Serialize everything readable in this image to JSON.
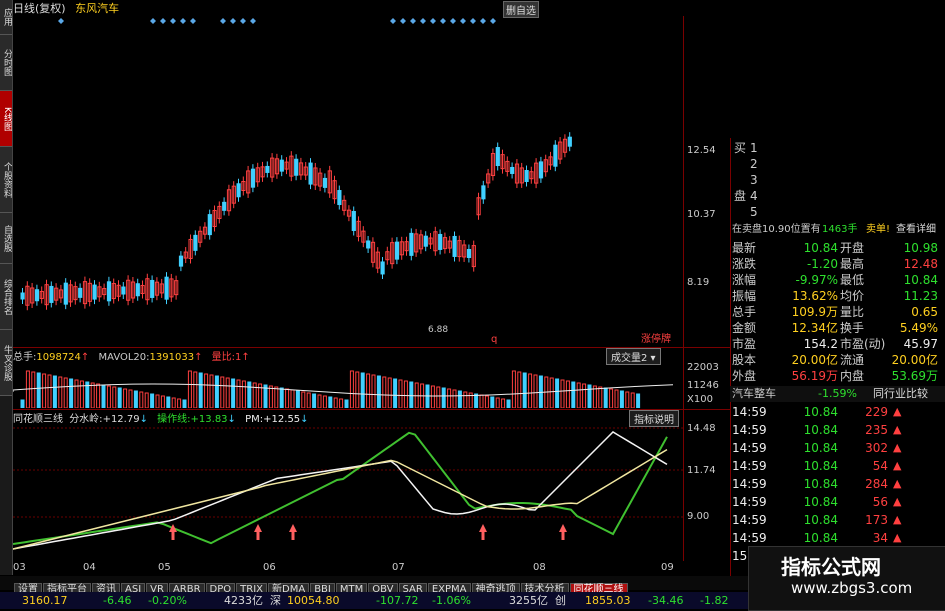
{
  "sidebar": {
    "tabs": [
      "应用",
      "分时图",
      "K线图",
      "个股资料",
      "自选股",
      "综合排名",
      "牛叉诊股"
    ]
  },
  "header": {
    "period": "日线(复权)",
    "stock_name": "东风汽车",
    "delete_button": "删自选"
  },
  "main_chart": {
    "price_axis": [
      "12.54",
      "10.37",
      "8.19"
    ],
    "low_marker": "6.88",
    "q_marker": "q",
    "zhangting_label": "涨停牌"
  },
  "volume": {
    "title": "总手:",
    "total": "1098724",
    "ma_label": "MAVOL20:",
    "ma_value": "1391033",
    "ratio_label": "量比:",
    "ratio_value": "1",
    "select_label": "成交量2",
    "axis": [
      "22003",
      "11246",
      "X100"
    ]
  },
  "indicator": {
    "name": "同花顺三线",
    "fs_label": "分水岭:",
    "fs_value": "+12.79",
    "op_label": "操作线:",
    "op_value": "+13.83",
    "pm_label": "PM:",
    "pm_value": "+12.55",
    "help_button": "指标说明",
    "axis": [
      "14.48",
      "11.74",
      "9.00"
    ]
  },
  "x_axis": [
    "03",
    "04",
    "05",
    "06",
    "07",
    "08",
    "09"
  ],
  "order_book": {
    "rows": [
      {
        "side": "买",
        "level": "1"
      },
      {
        "side": "",
        "level": "2"
      },
      {
        "side": "",
        "level": "3"
      },
      {
        "side": "盘",
        "level": "4"
      },
      {
        "side": "",
        "level": "5"
      }
    ]
  },
  "holding": {
    "text": "在卖盘10.90位置有",
    "qty": "1463手",
    "sell_button": "卖单!",
    "detail_button": "查看详细"
  },
  "quote": [
    {
      "l1": "最新",
      "v1": "10.84",
      "l2": "开盘",
      "v2": "10.98",
      "c1": "green",
      "c2": "green"
    },
    {
      "l1": "涨跌",
      "v1": "-1.20",
      "l2": "最高",
      "v2": "12.48",
      "c1": "green",
      "c2": "red"
    },
    {
      "l1": "涨幅",
      "v1": "-9.97%",
      "l2": "最低",
      "v2": "10.84",
      "c1": "green",
      "c2": "green"
    },
    {
      "l1": "振幅",
      "v1": "13.62%",
      "l2": "均价",
      "v2": "11.23",
      "c1": "yellow",
      "c2": "green"
    },
    {
      "l1": "总手",
      "v1": "109.9万",
      "l2": "量比",
      "v2": "0.65",
      "c1": "yellow",
      "c2": "yellow"
    },
    {
      "l1": "金额",
      "v1": "12.34亿",
      "l2": "换手",
      "v2": "5.49%",
      "c1": "yellow",
      "c2": "yellow"
    },
    {
      "l1": "市盈",
      "v1": "154.2",
      "l2": "市盈(动)",
      "v2": "45.97",
      "c1": "white",
      "c2": "white"
    },
    {
      "l1": "股本",
      "v1": "20.00亿",
      "l2": "流通",
      "v2": "20.00亿",
      "c1": "yellow",
      "c2": "yellow"
    },
    {
      "l1": "外盘",
      "v1": "56.19万",
      "l2": "内盘",
      "v2": "53.69万",
      "c1": "red",
      "c2": "green"
    }
  ],
  "sector": {
    "name": "汽车整车",
    "change": "-1.59%",
    "compare_button": "同行业比较"
  },
  "ticks": [
    {
      "time": "14:59",
      "price": "10.84",
      "vol": "229"
    },
    {
      "time": "14:59",
      "price": "10.84",
      "vol": "235"
    },
    {
      "time": "14:59",
      "price": "10.84",
      "vol": "302"
    },
    {
      "time": "14:59",
      "price": "10.84",
      "vol": "54"
    },
    {
      "time": "14:59",
      "price": "10.84",
      "vol": "284"
    },
    {
      "time": "14:59",
      "price": "10.84",
      "vol": "56"
    },
    {
      "time": "14:59",
      "price": "10.84",
      "vol": "173"
    },
    {
      "time": "14:59",
      "price": "10.84",
      "vol": "34"
    },
    {
      "time": "15:29",
      "price": "",
      "vol": ""
    }
  ],
  "tabs": [
    "设置",
    "指标平台",
    "资讯",
    "ASI",
    "VR",
    "ARBR",
    "DPO",
    "TRIX",
    "新DMA",
    "BBI",
    "MTM",
    "OBV",
    "SAR",
    "EXPMA",
    "神奇逃顶",
    "技术分析",
    "同花顺三线"
  ],
  "active_tab": "同花顺三线",
  "status": {
    "sh_index": "3160.17",
    "sh_change": "-6.46",
    "sh_pct": "-0.20%",
    "sh_amount": "4233亿",
    "sz_label": "深",
    "sz_index": "10054.80",
    "sz_change": "-107.72",
    "sz_pct": "-1.06%",
    "sz_amount": "3255亿",
    "cy_label": "创",
    "cy_index": "1855.03",
    "cy_change": "-34.46",
    "cy_pct": "-1.82"
  },
  "watermark": {
    "title": "指标公式网",
    "url": "www.zbgs3.com"
  },
  "colors": {
    "up": "#ff4040",
    "down": "#40d0ff",
    "green": "#2ee02e",
    "yellow": "#ffd020",
    "panel_border": "#7a0000"
  }
}
